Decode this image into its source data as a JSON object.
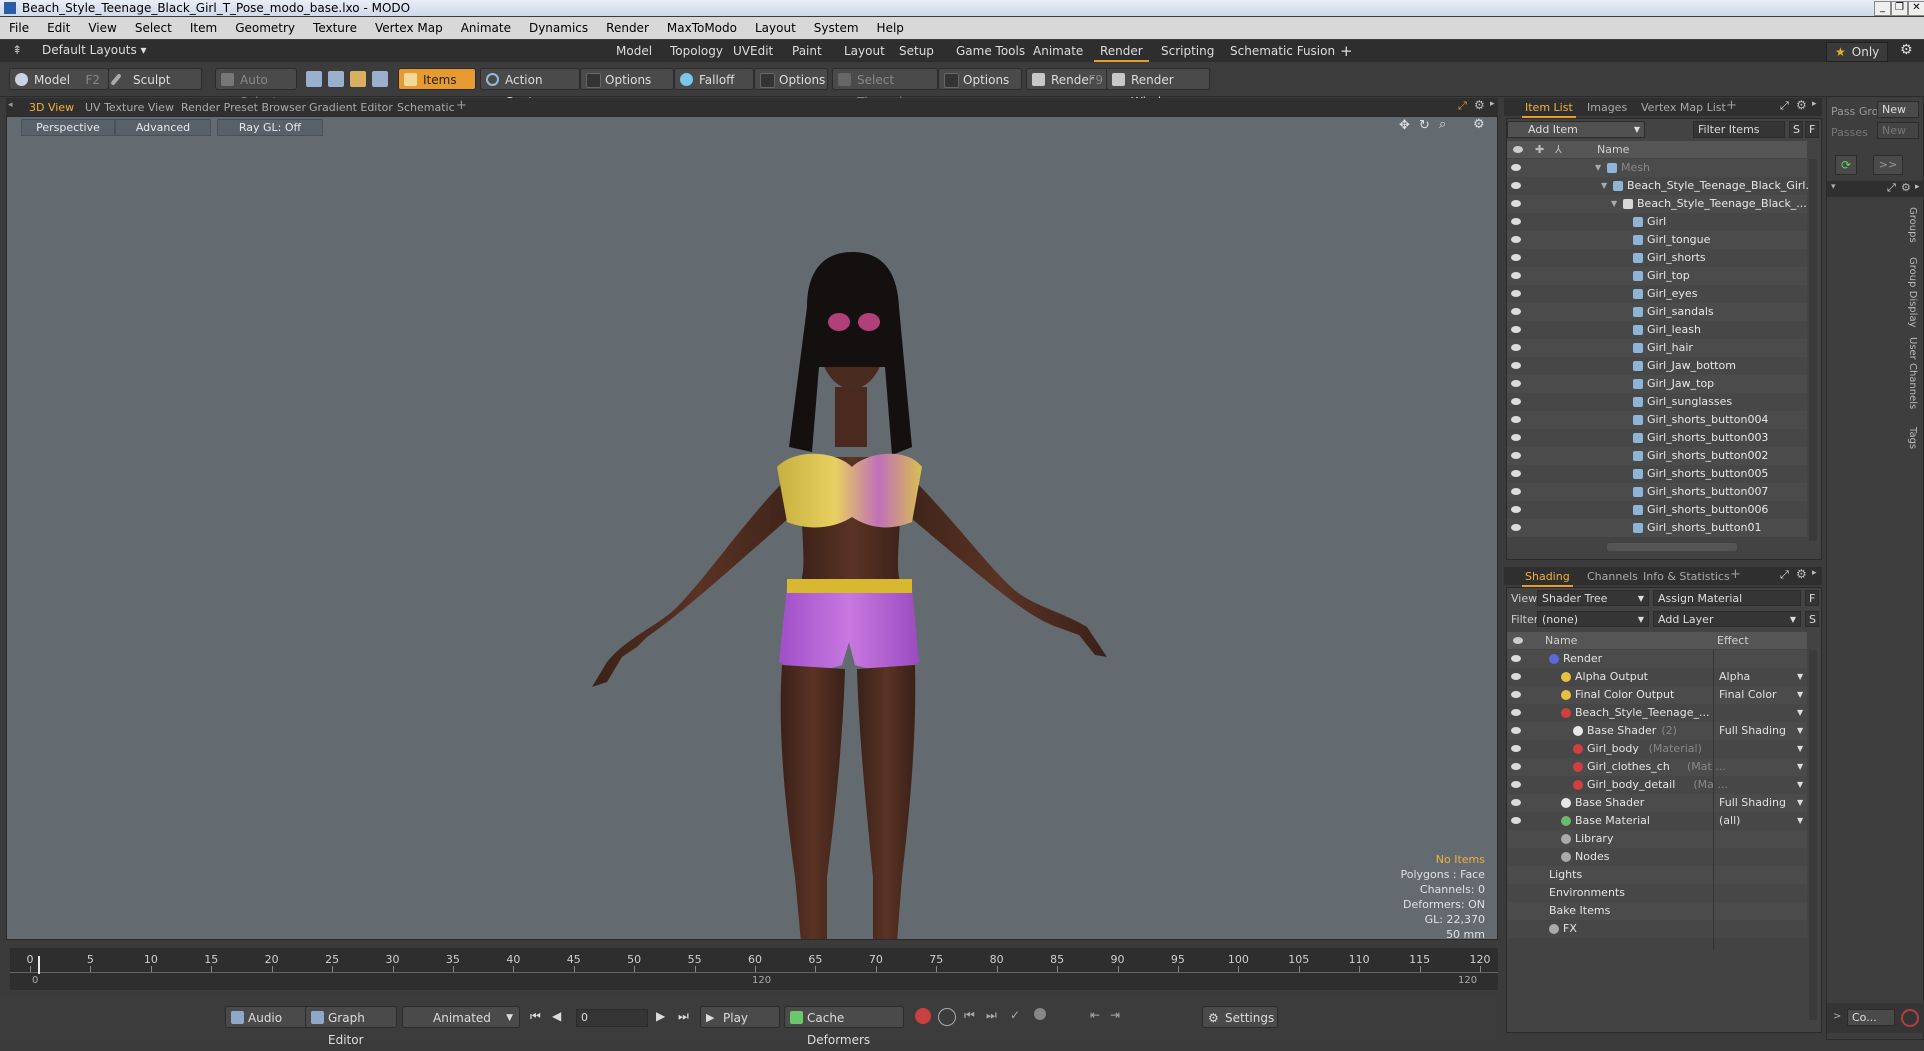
{
  "window": {
    "title": "Beach_Style_Teenage_Black_Girl_T_Pose_modo_base.lxo - MODO"
  },
  "menu": [
    "File",
    "Edit",
    "View",
    "Select",
    "Item",
    "Geometry",
    "Texture",
    "Vertex Map",
    "Animate",
    "Dynamics",
    "Render",
    "MaxToModo",
    "Layout",
    "System",
    "Help"
  ],
  "layout": {
    "default_layouts": "Default Layouts",
    "tabs": [
      "Model",
      "Topology",
      "UVEdit",
      "Paint",
      "Layout",
      "Setup",
      "Game Tools",
      "Animate",
      "Render",
      "Scripting",
      "Schematic Fusion"
    ],
    "active_tab": "Render",
    "only_label": "Only"
  },
  "toolbar": {
    "model": "Model",
    "model_key": "F2",
    "sculpt": "Sculpt",
    "auto_select": "Auto Select",
    "items": "Items",
    "action_center": "Action Center",
    "options1": "Options",
    "falloff": "Falloff",
    "options2": "Options",
    "select_through": "Select Through",
    "options3": "Options",
    "render": "Render",
    "render_key": "F9",
    "render_window": "Render Window"
  },
  "viewport_tabs": [
    "3D View",
    "UV Texture View",
    "Render Preset Browser",
    "Gradient Editor",
    "Schematic"
  ],
  "viewport": {
    "perspective": "Perspective",
    "advanced": "Advanced",
    "raygl": "Ray GL: Off",
    "stats": {
      "no_items": "No Items",
      "polygons": "Polygons : Face",
      "channels": "Channels: 0",
      "deformers": "Deformers: ON",
      "gl": "GL: 22,370",
      "focal": "50 mm"
    }
  },
  "timeline": {
    "labels": [
      "0",
      "5",
      "10",
      "15",
      "20",
      "25",
      "30",
      "35",
      "40",
      "45",
      "50",
      "55",
      "60",
      "65",
      "70",
      "75",
      "80",
      "85",
      "90",
      "95",
      "100",
      "105",
      "110",
      "115",
      "120"
    ],
    "start": "0",
    "mid": "120",
    "end": "120"
  },
  "bottom": {
    "audio": "Audio",
    "graph_editor": "Graph Editor",
    "animated": "Animated",
    "frame": "0",
    "play": "Play",
    "cache_deformers": "Cache Deformers",
    "settings": "Settings"
  },
  "item_panel": {
    "tabs": [
      "Item List",
      "Images",
      "Vertex Map List"
    ],
    "add_item": "Add Item",
    "filter_items": "Filter Items",
    "s": "S",
    "f": "F",
    "col_name": "Name",
    "items": [
      {
        "label": "Mesh",
        "indent": 0,
        "dim": true
      },
      {
        "label": "Beach_Style_Teenage_Black_Girl...",
        "indent": 1
      },
      {
        "label": "Beach_Style_Teenage_Black_...",
        "indent": 2
      },
      {
        "label": "Girl",
        "indent": 3
      },
      {
        "label": "Girl_tongue",
        "indent": 3
      },
      {
        "label": "Girl_shorts",
        "indent": 3
      },
      {
        "label": "Girl_top",
        "indent": 3
      },
      {
        "label": "Girl_eyes",
        "indent": 3
      },
      {
        "label": "Girl_sandals",
        "indent": 3
      },
      {
        "label": "Girl_leash",
        "indent": 3
      },
      {
        "label": "Girl_hair",
        "indent": 3
      },
      {
        "label": "Girl_Jaw_bottom",
        "indent": 3
      },
      {
        "label": "Girl_Jaw_top",
        "indent": 3
      },
      {
        "label": "Girl_sunglasses",
        "indent": 3
      },
      {
        "label": "Girl_shorts_button004",
        "indent": 3
      },
      {
        "label": "Girl_shorts_button003",
        "indent": 3
      },
      {
        "label": "Girl_shorts_button002",
        "indent": 3
      },
      {
        "label": "Girl_shorts_button005",
        "indent": 3
      },
      {
        "label": "Girl_shorts_button007",
        "indent": 3
      },
      {
        "label": "Girl_shorts_button006",
        "indent": 3
      },
      {
        "label": "Girl_shorts_button01",
        "indent": 3
      }
    ]
  },
  "shading_panel": {
    "tabs": [
      "Shading",
      "Channels",
      "Info & Statistics"
    ],
    "view_label": "View",
    "view_value": "Shader Tree",
    "assign_material": "Assign Material",
    "f": "F",
    "filter_label": "Filter",
    "filter_value": "(none)",
    "add_layer": "Add Layer",
    "s": "S",
    "col_name": "Name",
    "col_effect": "Effect",
    "rows": [
      {
        "label": "Render",
        "suffix": "",
        "effect": "",
        "indent": 0
      },
      {
        "label": "Alpha Output",
        "suffix": "",
        "effect": "Alpha",
        "indent": 1
      },
      {
        "label": "Final Color Output",
        "suffix": "",
        "effect": "Final Color",
        "indent": 1
      },
      {
        "label": "Beach_Style_Teenage_...",
        "suffix": "",
        "effect": "",
        "indent": 1
      },
      {
        "label": "Base Shader",
        "suffix": "(2)",
        "effect": "Full Shading",
        "indent": 2
      },
      {
        "label": "Girl_body",
        "suffix": "(Material)",
        "effect": "",
        "indent": 2
      },
      {
        "label": "Girl_clothes_ch",
        "suffix": "(Mat ...",
        "effect": "",
        "indent": 2
      },
      {
        "label": "Girl_body_detail",
        "suffix": "(Ma ...",
        "effect": "",
        "indent": 2
      },
      {
        "label": "Base Shader",
        "suffix": "",
        "effect": "Full Shading",
        "indent": 1
      },
      {
        "label": "Base Material",
        "suffix": "",
        "effect": "(all)",
        "indent": 1
      },
      {
        "label": "Library",
        "suffix": "",
        "effect": "",
        "indent": 1
      },
      {
        "label": "Nodes",
        "suffix": "",
        "effect": "",
        "indent": 1
      },
      {
        "label": "Lights",
        "suffix": "",
        "effect": "",
        "indent": 0
      },
      {
        "label": "Environments",
        "suffix": "",
        "effect": "",
        "indent": 0
      },
      {
        "label": "Bake Items",
        "suffix": "",
        "effect": "",
        "indent": 0
      },
      {
        "label": "FX",
        "suffix": "",
        "effect": "",
        "indent": 0
      }
    ]
  },
  "far_right": {
    "pass_grp": "Pass Gro",
    "new1": "New",
    "passes": "Passes",
    "new2": "New",
    "side_tabs": [
      "Groups",
      "Group Display",
      "User Channels",
      "Tags"
    ],
    "co": "Co..."
  },
  "colors": {
    "accent": "#e89c2a",
    "viewport_bg": "#636b71",
    "panel_bg": "#434343"
  }
}
